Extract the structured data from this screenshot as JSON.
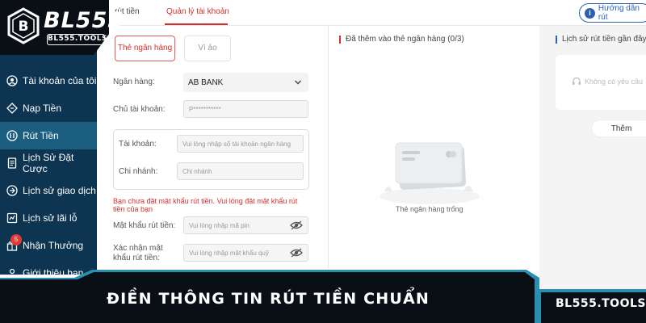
{
  "brand": {
    "logo_text": "BL555",
    "logo_sub": "BL555.TOOLS",
    "badge_letter": "B"
  },
  "sidebar": {
    "items": [
      {
        "label": "Tài khoản của tôi",
        "icon": "account-circle-icon"
      },
      {
        "label": "Nạp Tiền",
        "icon": "deposit-diamond-icon"
      },
      {
        "label": "Rút Tiền",
        "icon": "withdraw-icon",
        "active": true
      },
      {
        "label": "Lịch Sử Đặt Cược",
        "icon": "document-icon"
      },
      {
        "label": "Lịch sử giao dịch",
        "icon": "transaction-icon"
      },
      {
        "label": "Lịch sử lãi lỗ",
        "icon": "profit-loss-icon"
      },
      {
        "label": "Nhận Thưởng",
        "icon": "gift-icon",
        "badge": "5"
      },
      {
        "label": "Giới thiệu bạn",
        "icon": "invite-icon"
      }
    ]
  },
  "topbar": {
    "tab_withdraw": "rút tiền",
    "tab_account_mgmt": "Quản lý tài khoản",
    "guide_label": "Hướng dẫn rút",
    "guide_icon": "i"
  },
  "form": {
    "tab_bank_card": "Thẻ ngân hàng",
    "tab_wallet": "Ví ảo",
    "bank_label": "Ngân hàng:",
    "bank_value": "AB BANK",
    "holder_label": "Chủ tài khoản:",
    "holder_value": "P***********",
    "account_label": "Tài khoản:",
    "account_placeholder": "Vui lòng nhập số tài khoản ngân hàng",
    "branch_label": "Chi nhánh:",
    "branch_placeholder": "Chi nhánh",
    "warning": "Bạn chưa đặt mật khẩu rút tiền. Vui lòng đặt mật khẩu rút tiền của bạn",
    "pin_label": "Mật khẩu rút tiền:",
    "pin_placeholder": "Vui lòng nhập mã pin",
    "confirm_label": "Xác nhận mật khẩu rút tiền:",
    "confirm_placeholder": "Vui lòng nhập mật khẩu quỹ"
  },
  "middle": {
    "title": "Đã thêm vào thẻ ngân hàng  (0/3)",
    "empty_text": "Thẻ ngân hàng trống"
  },
  "right": {
    "title": "Lịch sử rút tiền gần đây",
    "empty_text": "Không có yêu cầu",
    "add_button": "Thêm"
  },
  "banner": {
    "headline": "ĐIỀN THÔNG TIN RÚT TIỀN CHUẨN",
    "brand": "BL555.TOOLS"
  },
  "colors": {
    "sidebar_bg": "#0d3552",
    "sidebar_active": "#1b5e80",
    "accent_red": "#d32f2f",
    "accent_blue": "#2d5fb8",
    "banner_dark": "#0a0f16",
    "banner_stripe": "#2a8fb0"
  }
}
